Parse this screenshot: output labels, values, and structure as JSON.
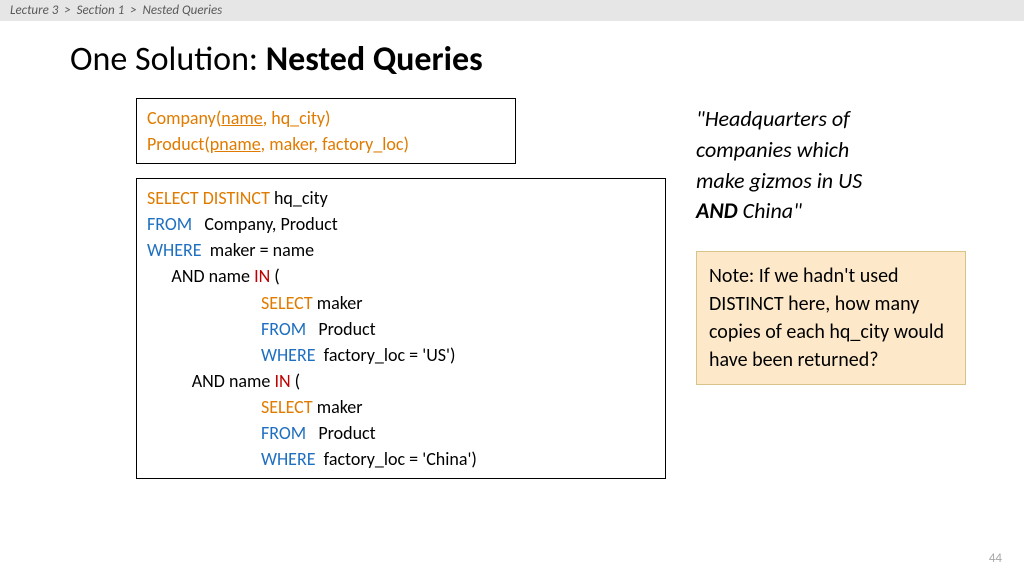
{
  "breadcrumb": {
    "l1": "Lecture 3",
    "l2": "Section 1",
    "l3": "Nested Queries",
    "sep": ">"
  },
  "title": {
    "prefix": "One Solution: ",
    "main": "Nested Queries"
  },
  "schema": {
    "company_rel": "Company(",
    "company_key": "name",
    "company_rest": ", hq_city)",
    "product_rel": "Product(",
    "product_key": "pname",
    "product_rest": ", maker, factory_loc)"
  },
  "sql": {
    "SELECT": "SELECT ",
    "DISTINCT": "DISTINCT ",
    "hq_city": "hq_city",
    "FROM": "FROM",
    "companies": "   Company, Product",
    "WHERE": "WHERE",
    "cond1": "  maker = name",
    "and1_pre": "      AND name ",
    "IN": "IN",
    "open": " (",
    "sub_select": "SELECT ",
    "sub_maker": "maker",
    "sub_from": "FROM",
    "sub_product": "   Product",
    "sub_where": "WHERE",
    "loc_us": "  factory_loc = 'US')",
    "and2_pre": "           AND name ",
    "loc_china": "  factory_loc = 'China')",
    "ind_sub": "                            "
  },
  "quote": {
    "open": "\"",
    "l1": "Headquarters of ",
    "l2": "companies which ",
    "l3": "make gizmos in US ",
    "and": "AND",
    "l4": " China\""
  },
  "note": "Note: If we hadn't used DISTINCT here, how many copies of each hq_city would have been returned?",
  "page": "44"
}
